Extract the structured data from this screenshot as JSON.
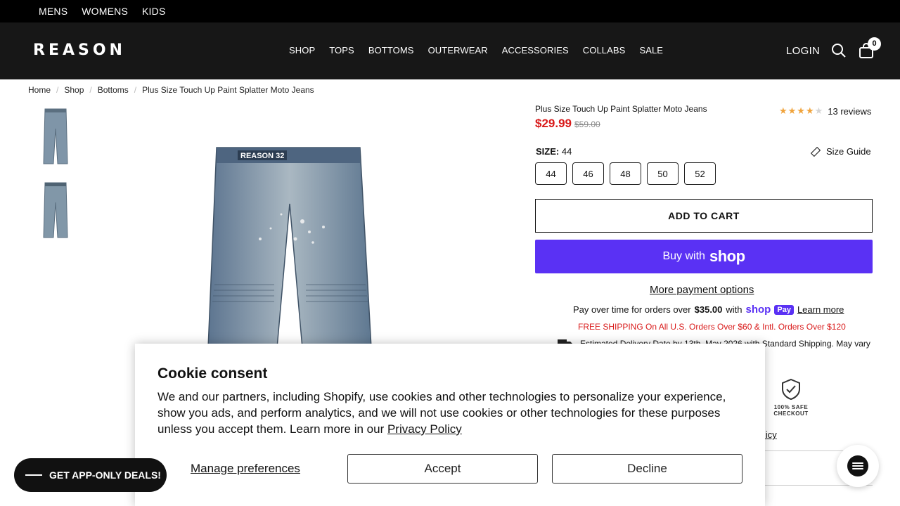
{
  "topbar": {
    "links": [
      "MENS",
      "WOMENS",
      "KIDS"
    ]
  },
  "header": {
    "logo": "REASON",
    "nav": [
      "SHOP",
      "TOPS",
      "BOTTOMS",
      "OUTERWEAR",
      "ACCESSORIES",
      "COLLABS",
      "SALE"
    ],
    "login": "LOGIN",
    "cart_count": "0"
  },
  "breadcrumb": [
    "Home",
    "Shop",
    "Bottoms",
    "Plus Size Touch Up Paint Splatter Moto Jeans"
  ],
  "product": {
    "title": "Plus Size Touch Up Paint Splatter Moto Jeans",
    "rating_stars": 4,
    "reviews": "13 reviews",
    "price": "$29.99",
    "compare_price": "$59.00",
    "size_label": "SIZE:",
    "selected_size": "44",
    "size_guide": "Size Guide",
    "sizes": [
      "44",
      "46",
      "48",
      "50",
      "52"
    ],
    "add_to_cart": "ADD TO CART",
    "buy_with": "Buy with",
    "buy_brand": "shop",
    "more_payment": "More payment options",
    "pay_over": "Pay over time for orders over",
    "pay_amount": "$35.00",
    "pay_with": "with",
    "shop_word": "shop",
    "shoppay_badge": "Pay",
    "learn_more": "Learn more",
    "free_shipping": "FREE SHIPPING On All U.S. Orders Over $60 & Intl. Orders Over $120",
    "delivery": "Estimated Delivery Date by 13th, May 2026 with Standard Shipping. May vary",
    "safe_line1": "100% SAFE",
    "safe_line2": "CHECKOUT",
    "policy_tail": "licy"
  },
  "cookie": {
    "title": "Cookie consent",
    "body": "We and our partners, including Shopify, use cookies and other technologies to personalize your experience, show you ads, and perform analytics, and we will not use cookies or other technologies for these purposes unless you accept them. Learn more in our",
    "privacy_link": "Privacy Policy",
    "manage": "Manage preferences",
    "accept": "Accept",
    "decline": "Decline"
  },
  "deals_button": "GET APP-ONLY DEALS!",
  "colors": {
    "sale_red": "#d91b1b",
    "shop_purple": "#5a31f4",
    "star": "#f0a33b"
  }
}
